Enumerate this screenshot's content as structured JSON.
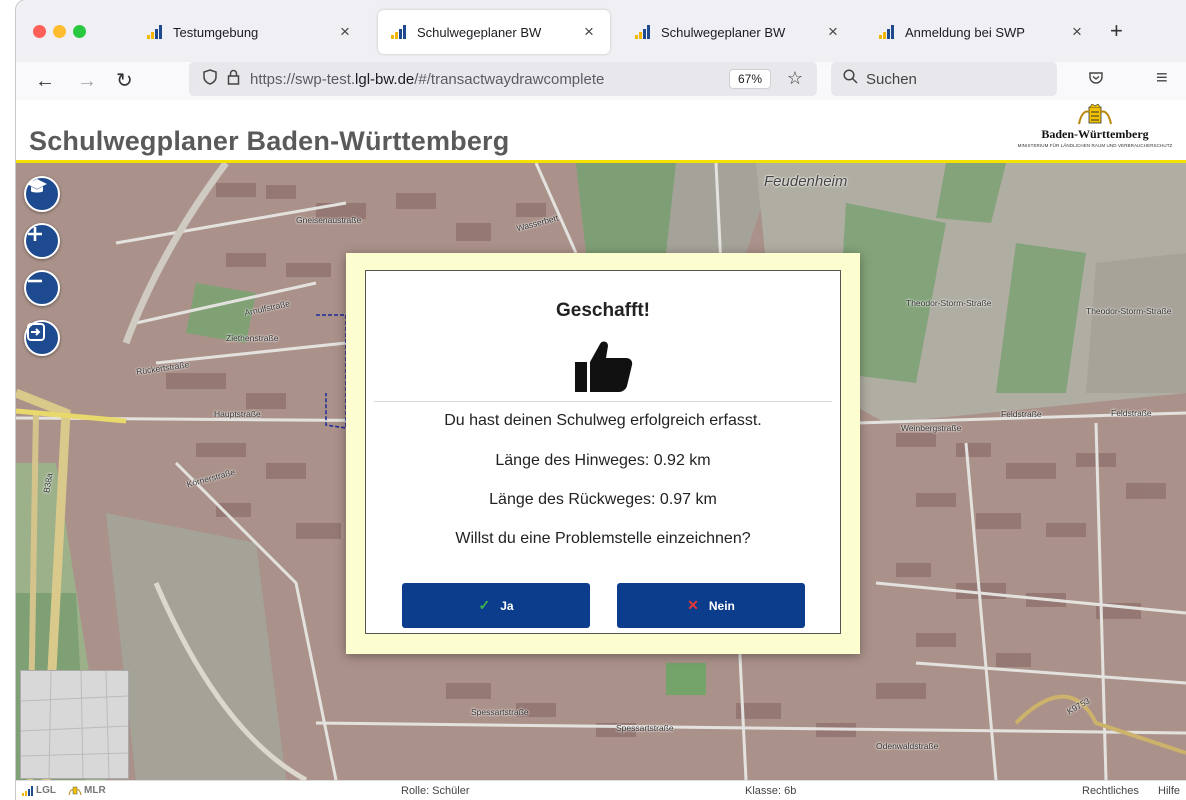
{
  "browser": {
    "tabs": [
      {
        "title": "Testumgebung",
        "active": false
      },
      {
        "title": "Schulwegeplaner BW",
        "active": true
      },
      {
        "title": "Schulwegeplaner BW",
        "active": false
      },
      {
        "title": "Anmeldung bei SWP",
        "active": false
      }
    ],
    "close_glyph": "×",
    "new_tab_glyph": "+",
    "url": {
      "prefix": "https://swp-test.",
      "domain": "lgl-bw.de",
      "suffix": "/#/transactwaydrawcomplete"
    },
    "zoom": "67%",
    "search_placeholder": "Suchen"
  },
  "app": {
    "title": "Schulwegplaner Baden-Württemberg",
    "logo_name": "Baden-Württemberg",
    "logo_ministry": "MINISTERIUM FÜR LÄNDLICHEN RAUM UND VERBRAUCHERSCHUTZ"
  },
  "map": {
    "place_label": "Feudenheim",
    "street_labels": [
      "Gneisenaustraße",
      "Wasserbett",
      "Arnulfstraße",
      "Ziethenstraße",
      "Rückertstraße",
      "Hauptstraße",
      "Körnerstraße",
      "Theodor-Storm-Straße",
      "Feldstraße",
      "Weinbergstraße",
      "Spessartstraße",
      "Odenwaldstraße",
      "B38a",
      "K9753"
    ]
  },
  "modal": {
    "title": "Geschafft!",
    "success": "Du hast deinen Schulweg erfolgreich erfasst.",
    "hinweg": "Länge des Hinweges: 0.92 km",
    "rueckweg": "Länge des Rückweges: 0.97 km",
    "question": "Willst du eine Problemstelle einzeichnen?",
    "yes_label": "Ja",
    "no_label": "Nein"
  },
  "footer": {
    "logo_lgl": "LGL",
    "logo_mlr": "MLR",
    "rolle": "Rolle: Schüler",
    "klasse": "Klasse: 6b",
    "rechtliches": "Rechtliches",
    "hilfe": "Hilfe"
  },
  "colors": {
    "header_accent": "#f5e100",
    "button_blue": "#0c3c8c",
    "map_control_blue": "#1e4a8f",
    "modal_frame": "#fdfed0"
  }
}
